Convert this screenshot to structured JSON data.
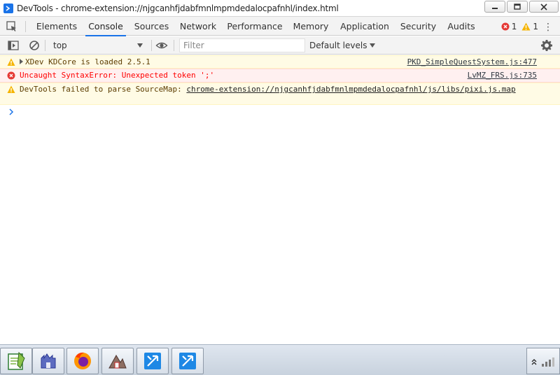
{
  "window": {
    "title": "DevTools - chrome-extension://njgcanhfjdabfmnlmpmdedalocpafnhl/index.html",
    "icons": [
      "devtools-app-icon",
      "minimize-icon",
      "maximize-icon",
      "close-icon"
    ]
  },
  "tabs": [
    {
      "label": "Elements"
    },
    {
      "label": "Console"
    },
    {
      "label": "Sources"
    },
    {
      "label": "Network"
    },
    {
      "label": "Performance"
    },
    {
      "label": "Memory"
    },
    {
      "label": "Application"
    },
    {
      "label": "Security"
    },
    {
      "label": "Audits"
    }
  ],
  "active_tab": "Console",
  "counters": {
    "errors": "1",
    "warnings": "1"
  },
  "toolbar": {
    "context": "top",
    "filter_placeholder": "Filter",
    "levels": "Default levels"
  },
  "messages": [
    {
      "level": "warning",
      "text": "XDev KDCore is loaded 2.5.1",
      "source": "PKD_SimpleQuestSystem.js:477"
    },
    {
      "level": "error",
      "text": "Uncaught SyntaxError: Unexpected token ';'",
      "source": "LvMZ_FRS.js:735"
    },
    {
      "level": "warning",
      "text": "DevTools failed to parse SourceMap: ",
      "link": "chrome-extension://njgcanhfjdabfmnlmpmdedalocpafnhl/js/libs/pixi.js.map"
    }
  ],
  "colors": {
    "accent": "#1a73e8",
    "error": "#ff0000",
    "warning_bg": "#fffbe5",
    "error_bg": "#fff0f0"
  },
  "taskbar": {
    "apps": [
      "notepad-plus-icon",
      "rpg-maker-icon",
      "firefox-icon",
      "game-app-icon",
      "app-arrow-icon",
      "app-arrow-icon-2"
    ]
  }
}
